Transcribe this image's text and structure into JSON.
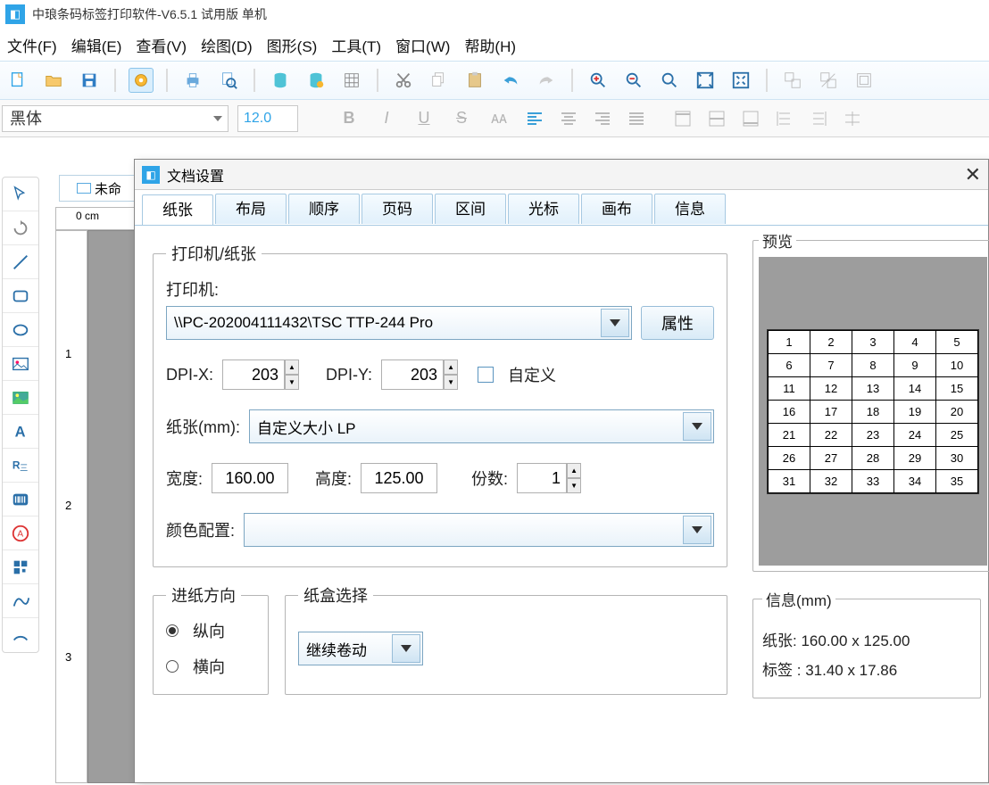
{
  "app": {
    "title": "中琅条码标签打印软件-V6.5.1 试用版 单机"
  },
  "menu": {
    "file": "文件(F)",
    "edit": "编辑(E)",
    "view": "查看(V)",
    "draw": "绘图(D)",
    "shape": "图形(S)",
    "tool": "工具(T)",
    "window": "窗口(W)",
    "help": "帮助(H)"
  },
  "fontbar": {
    "fontname": "黑体",
    "fontsize": "12.0"
  },
  "doctab": "未命",
  "ruler": {
    "unit": "0 cm",
    "v": [
      "1",
      "2",
      "3"
    ]
  },
  "dialog": {
    "title": "文档设置",
    "tabs": [
      "纸张",
      "布局",
      "顺序",
      "页码",
      "区间",
      "光标",
      "画布",
      "信息"
    ],
    "fieldsets": {
      "printerPaper": "打印机/纸张",
      "feedDirection": "进纸方向",
      "tray": "纸盒选择"
    },
    "labels": {
      "printer": "打印机:",
      "props": "属性",
      "dpix": "DPI-X:",
      "dpiy": "DPI-Y:",
      "custom": "自定义",
      "paperMm": "纸张(mm):",
      "width": "宽度:",
      "height": "高度:",
      "copies": "份数:",
      "colorProfile": "颜色配置:",
      "portrait": "纵向",
      "landscape": "横向",
      "trayValue": "继续卷动"
    },
    "values": {
      "printer": "\\\\PC-202004111432\\TSC TTP-244 Pro",
      "dpix": "203",
      "dpiy": "203",
      "paperSize": "自定义大小 LP",
      "width": "160.00",
      "height": "125.00",
      "copies": "1",
      "colorProfile": ""
    },
    "preview": {
      "legend": "预览",
      "rows": 7,
      "cols": 5
    },
    "info": {
      "legend": "信息(mm)",
      "paperLabel": "纸张:",
      "paperValue": "160.00 x 125.00",
      "labelLabel": "标签 :",
      "labelValue": "31.40 x 17.86"
    }
  }
}
